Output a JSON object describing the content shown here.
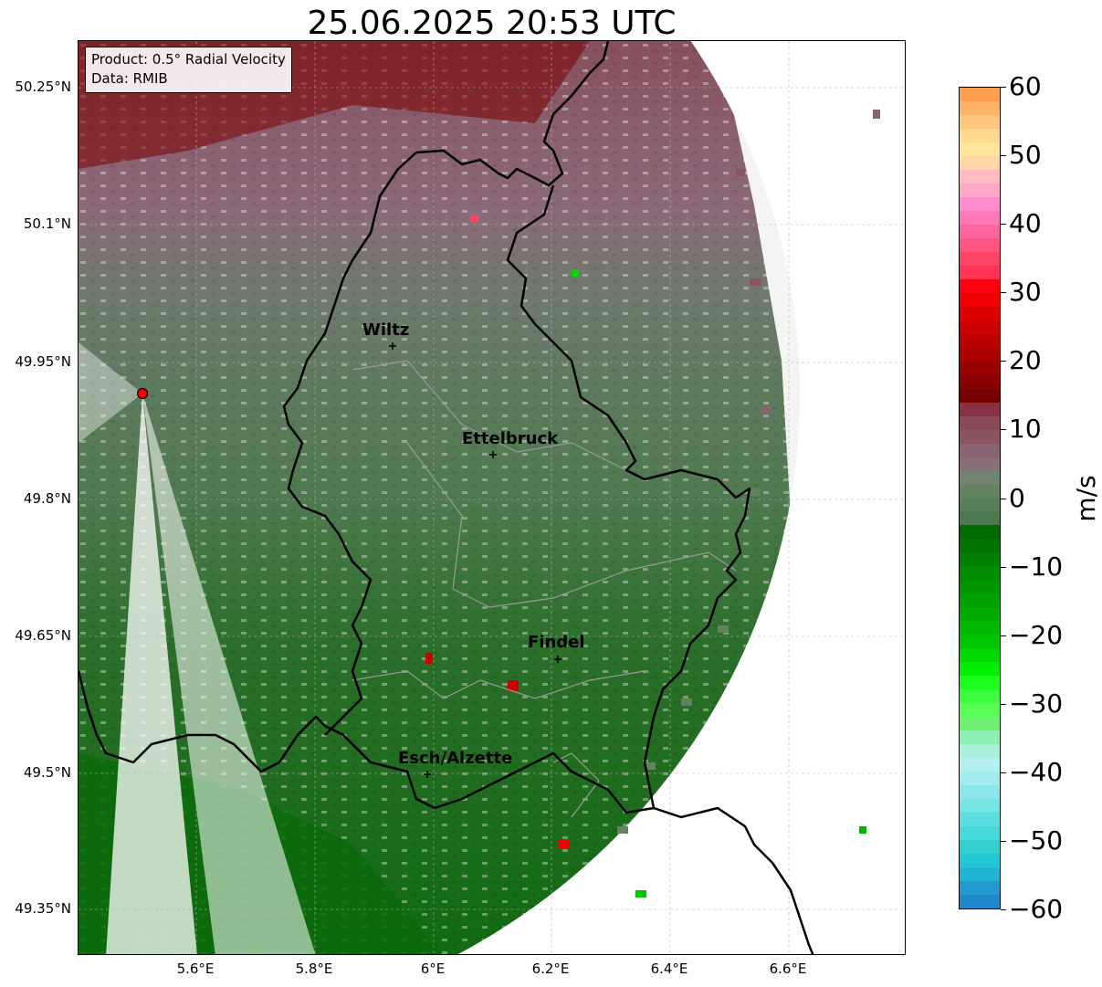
{
  "title": "25.06.2025 20:53 UTC",
  "info_box": {
    "product": "Product: 0.5° Radial Velocity",
    "data_source": "Data: RMIB"
  },
  "lat_ticks": [
    "50.25°N",
    "50.1°N",
    "49.95°N",
    "49.8°N",
    "49.65°N",
    "49.5°N",
    "49.35°N"
  ],
  "lon_ticks": [
    "5.6°E",
    "5.8°E",
    "6°E",
    "6.2°E",
    "6.4°E",
    "6.6°E"
  ],
  "cities": [
    {
      "name": "Wiltz"
    },
    {
      "name": "Ettelbruck"
    },
    {
      "name": "Findel"
    },
    {
      "name": "Esch/Alzette"
    }
  ],
  "colorbar": {
    "unit": "m/s",
    "min": -60,
    "max": 60,
    "tick_labels": [
      "60",
      "50",
      "40",
      "30",
      "20",
      "10",
      "0",
      "−10",
      "−20",
      "−30",
      "−40",
      "−50",
      "−60"
    ],
    "colors": [
      "#ff9f50",
      "#ffb366",
      "#ffc680",
      "#ffd98f",
      "#ffe49c",
      "#ffd6a8",
      "#ffbcc0",
      "#ffa8c8",
      "#ff8ccc",
      "#ff78b8",
      "#ff66a0",
      "#ff5580",
      "#ff4466",
      "#ff3355",
      "#ff0010",
      "#ee0000",
      "#dd0000",
      "#cc0000",
      "#bb0000",
      "#aa0000",
      "#990000",
      "#880000",
      "#770000",
      "#883344",
      "#8a4a55",
      "#8a5560",
      "#886470",
      "#887078",
      "#708470",
      "#628262",
      "#588058",
      "#4e784e",
      "#006a00",
      "#007400",
      "#008000",
      "#008c00",
      "#009600",
      "#00a000",
      "#00ac00",
      "#00b800",
      "#00c400",
      "#00d800",
      "#00ee00",
      "#1cff1c",
      "#3cff3c",
      "#58ff58",
      "#70f070",
      "#8cf0b0",
      "#a8f0d8",
      "#b4f0f0",
      "#a0ecec",
      "#8ce8e8",
      "#74e4e4",
      "#5cdede",
      "#48d8d8",
      "#34d0d0",
      "#22c8d4",
      "#22b4d4",
      "#229ad0",
      "#2288cc"
    ]
  },
  "radar_site_color": "#ff0000"
}
